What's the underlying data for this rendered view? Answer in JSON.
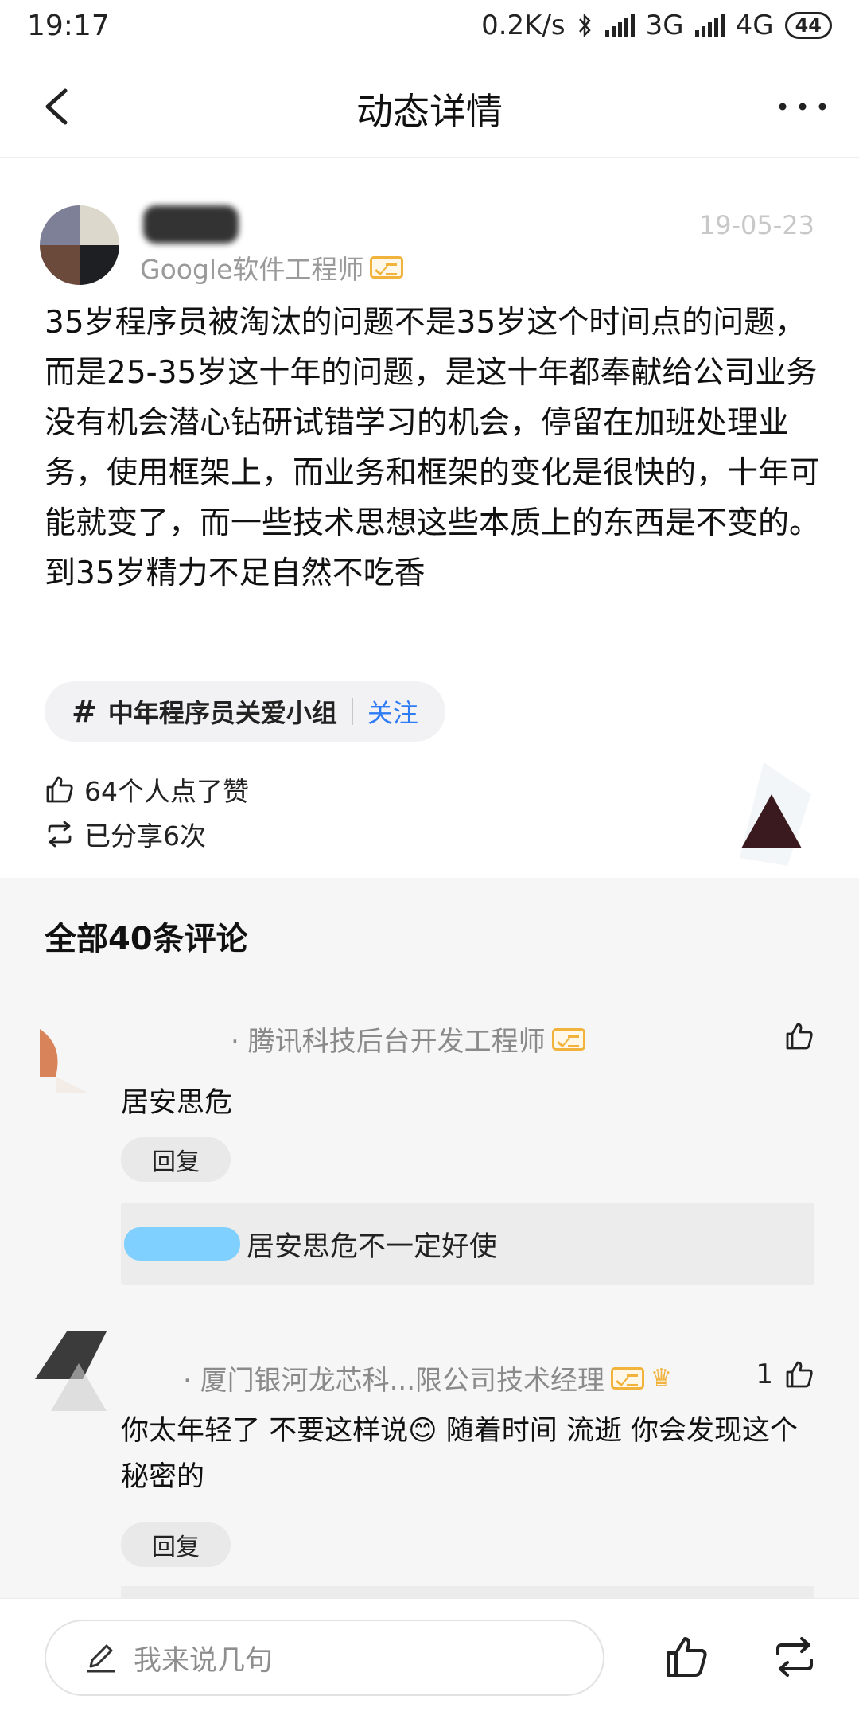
{
  "status_bar": {
    "time": "19:17",
    "speed": "0.2K/s",
    "net1": "3G",
    "net2": "4G",
    "battery": "44"
  },
  "header": {
    "title": "动态详情"
  },
  "post": {
    "date": "19-05-23",
    "author_title": "Google软件工程师",
    "text": "35岁程序员被淘汰的问题不是35岁这个时间点的问题，而是25-35岁这十年的问题，是这十年都奉献给公司业务没有机会潜心钻研试错学习的机会，停留在加班处理业务，使用框架上，而业务和框架的变化是很快的，十年可能就变了，而一些技术思想这些本质上的东西是不变的。到35岁精力不足自然不吃香",
    "topic": {
      "hash": "#",
      "name": "中年程序员关爱小组",
      "follow_label": "关注"
    },
    "likes_text": "64个人点了赞",
    "shares_text": "已分享6次"
  },
  "comments": {
    "title": "全部40条评论",
    "items": [
      {
        "author_title": "· 腾讯科技后台开发工程师",
        "text": "居安思危",
        "reply_label": "回复",
        "like_count": "",
        "sub_reply": "居安思危不一定好使"
      },
      {
        "author_title": "· 厦门银河龙芯科...限公司技术经理",
        "text": "你太年轻了 不要这样说😊 随着时间 流逝 你会发现这个秘密的",
        "reply_label": "回复",
        "like_count": "1"
      }
    ]
  },
  "bottom_bar": {
    "input_placeholder": "我来说几句"
  },
  "colors": {
    "accent": "#2e7bf6",
    "badge": "#f2b33d",
    "muted": "#9a9a9a"
  }
}
